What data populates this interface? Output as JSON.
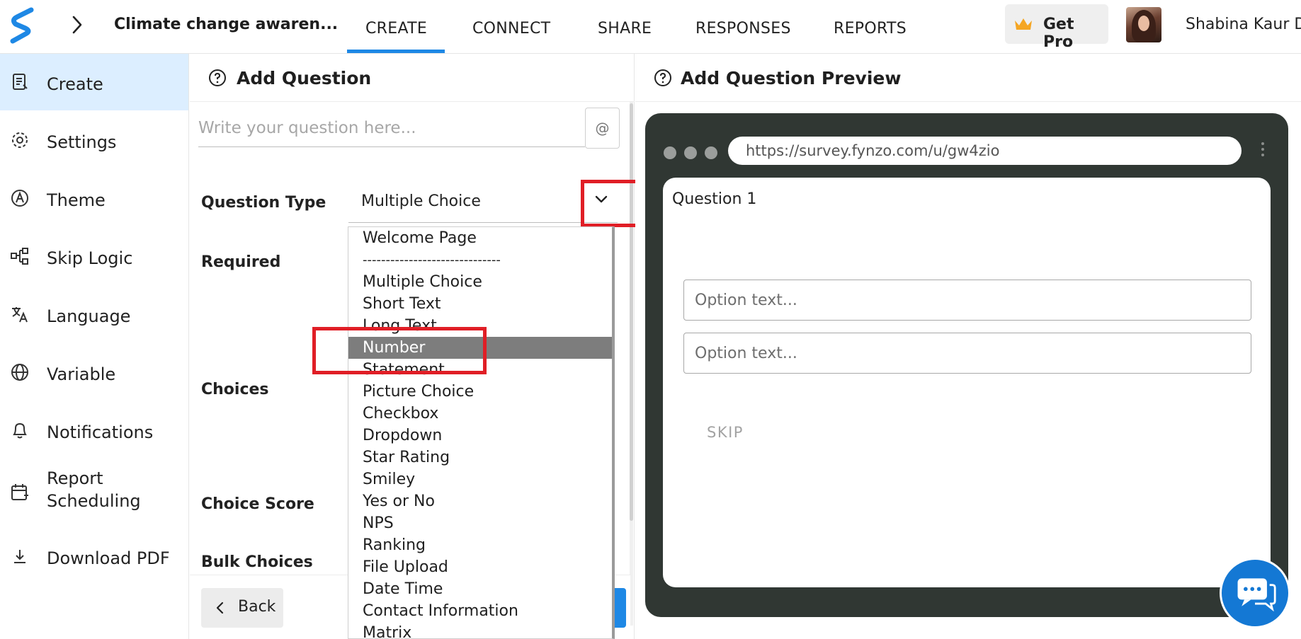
{
  "topbar": {
    "survey_title": "Climate change awaren...",
    "tabs": [
      {
        "label": "CREATE",
        "active": true
      },
      {
        "label": "CONNECT"
      },
      {
        "label": "SHARE"
      },
      {
        "label": "RESPONSES"
      },
      {
        "label": "REPORTS"
      }
    ],
    "get_pro_label": "Get Pro",
    "user_name": "Shabina Kaur Dh",
    "accent_color": "#1e88e5"
  },
  "sidebar": {
    "items": [
      {
        "label": "Create",
        "icon": "create-icon",
        "active": true
      },
      {
        "label": "Settings",
        "icon": "gear-icon"
      },
      {
        "label": "Theme",
        "icon": "theme-icon"
      },
      {
        "label": "Skip Logic",
        "icon": "skip-logic-icon"
      },
      {
        "label": "Language",
        "icon": "language-icon"
      },
      {
        "label": "Variable",
        "icon": "globe-icon"
      },
      {
        "label": "Notifications",
        "icon": "bell-icon"
      },
      {
        "label": "Report Scheduling",
        "icon": "calendar-icon"
      },
      {
        "label": "Download PDF",
        "icon": "download-icon"
      }
    ]
  },
  "editor": {
    "title": "Add Question",
    "question_placeholder": "Write your question here...",
    "at_button": "@",
    "question_type_label": "Question Type",
    "question_type_value": "Multiple Choice",
    "required_label": "Required",
    "choices_label": "Choices",
    "choice_score_label": "Choice Score",
    "bulk_choices_label": "Bulk Choices",
    "back_label": "Back"
  },
  "dropdown": {
    "options": [
      "Welcome Page",
      "------------------------------",
      "Multiple Choice",
      "Short Text",
      "Long Text",
      "Number",
      "Statement",
      "Picture Choice",
      "Checkbox",
      "Dropdown",
      "Star Rating",
      "Smiley",
      "Yes or No",
      "NPS",
      "Ranking",
      "File Upload",
      "Date Time",
      "Contact Information",
      "Matrix"
    ],
    "selected": "Number",
    "highlight_color": "#e01e26"
  },
  "preview": {
    "title": "Add Question Preview",
    "url": "https://survey.fynzo.com/u/gw4zio",
    "question_label": "Question 1",
    "option_placeholders": [
      "Option text...",
      "Option text..."
    ],
    "skip_label": "SKIP",
    "frame_color": "#303733"
  },
  "chat": {
    "icon": "chat-icon",
    "color": "#1478d4"
  }
}
